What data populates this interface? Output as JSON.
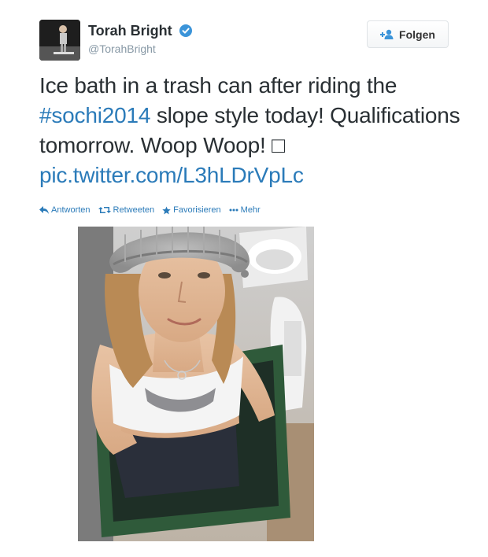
{
  "user": {
    "name": "Torah Bright",
    "handle": "@TorahBright"
  },
  "follow_button": {
    "label": "Folgen"
  },
  "tweet": {
    "text_part1": "Ice bath in a trash can after riding the ",
    "hashtag": "#sochi2014",
    "text_part2": " slope style today! Qualifications tomorrow. Woop Woop! ",
    "missing_glyph": "□",
    "link": "pic.twitter.com/L3hLDrVpLc"
  },
  "actions": {
    "reply": "Antworten",
    "retweet": "Retweeten",
    "favorite": "Favorisieren",
    "more": "Mehr"
  },
  "colors": {
    "link": "#2b7bb9",
    "verified": "#3b94d9",
    "text": "#292f33",
    "muted": "#8899a6"
  }
}
